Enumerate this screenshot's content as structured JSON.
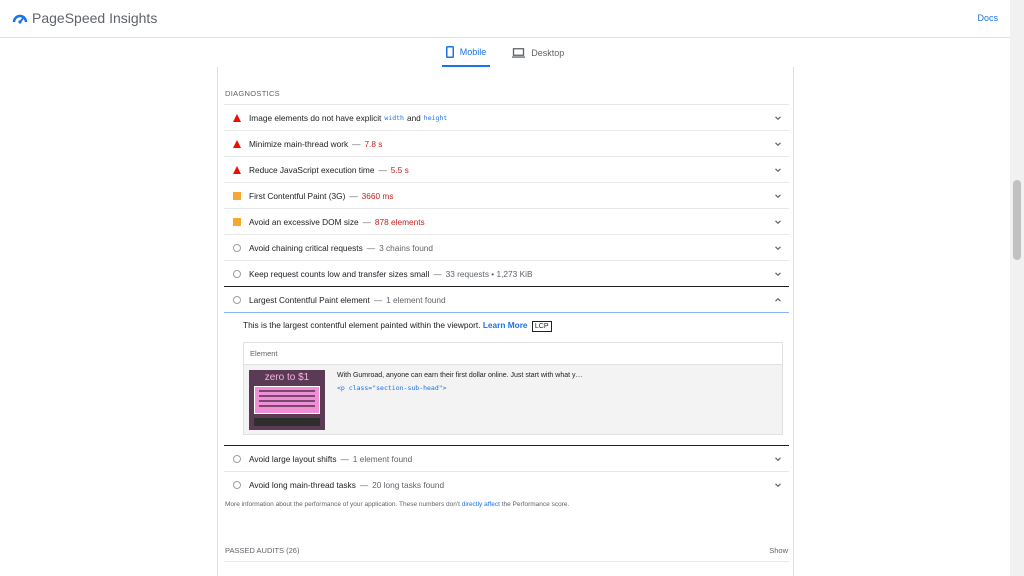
{
  "header": {
    "app_title": "PageSpeed Insights",
    "docs_label": "Docs",
    "brand_color": "#1a73e8"
  },
  "tabs": [
    {
      "label": "Mobile",
      "icon": "phone-icon",
      "active": true
    },
    {
      "label": "Desktop",
      "icon": "laptop-icon",
      "active": false
    }
  ],
  "diagnostics": {
    "title": "DIAGNOSTICS",
    "audits": [
      {
        "status": "fail",
        "label": "Image elements do not have explicit",
        "code1": "width",
        "mid": "and",
        "code2": "height",
        "value": ""
      },
      {
        "status": "fail",
        "label": "Minimize main-thread work",
        "value": "7.8 s"
      },
      {
        "status": "fail",
        "label": "Reduce JavaScript execution time",
        "value": "5.5 s"
      },
      {
        "status": "average",
        "label": "First Contentful Paint (3G)",
        "value": "3660 ms"
      },
      {
        "status": "average",
        "label": "Avoid an excessive DOM size",
        "value": "878 elements"
      },
      {
        "status": "info",
        "label": "Avoid chaining critical requests",
        "value": "3 chains found"
      },
      {
        "status": "info",
        "label": "Keep request counts low and transfer sizes small",
        "value": "33 requests • 1,273 KiB"
      },
      {
        "status": "info",
        "label": "Largest Contentful Paint element",
        "value": "1 element found"
      },
      {
        "status": "info",
        "label": "Avoid large layout shifts",
        "value": "1 element found"
      },
      {
        "status": "info",
        "label": "Avoid long main-thread tasks",
        "value": "20 long tasks found"
      }
    ],
    "separator": "—",
    "lcp_detail": {
      "description": "This is the largest contentful element painted within the viewport.",
      "learn_more": "Learn More",
      "badge": "LCP",
      "table_header": "Element",
      "snippet_text": "With Gumroad, anyone can earn their first dollar online. Just start with what y…",
      "snippet_code": "<p class=\"section-sub-head\">",
      "thumb_title": "zero to $1"
    },
    "footnote": {
      "before": "More information about the performance of your application. These numbers don't",
      "link": "directly affect",
      "after": "the Performance score."
    }
  },
  "passed": {
    "title": "PASSED AUDITS (26)",
    "show_label": "Show"
  },
  "colors": {
    "fail": "#eb0f00",
    "average": "#f8a832",
    "info_border": "#9aa0a6",
    "value_red": "#c5221f"
  }
}
